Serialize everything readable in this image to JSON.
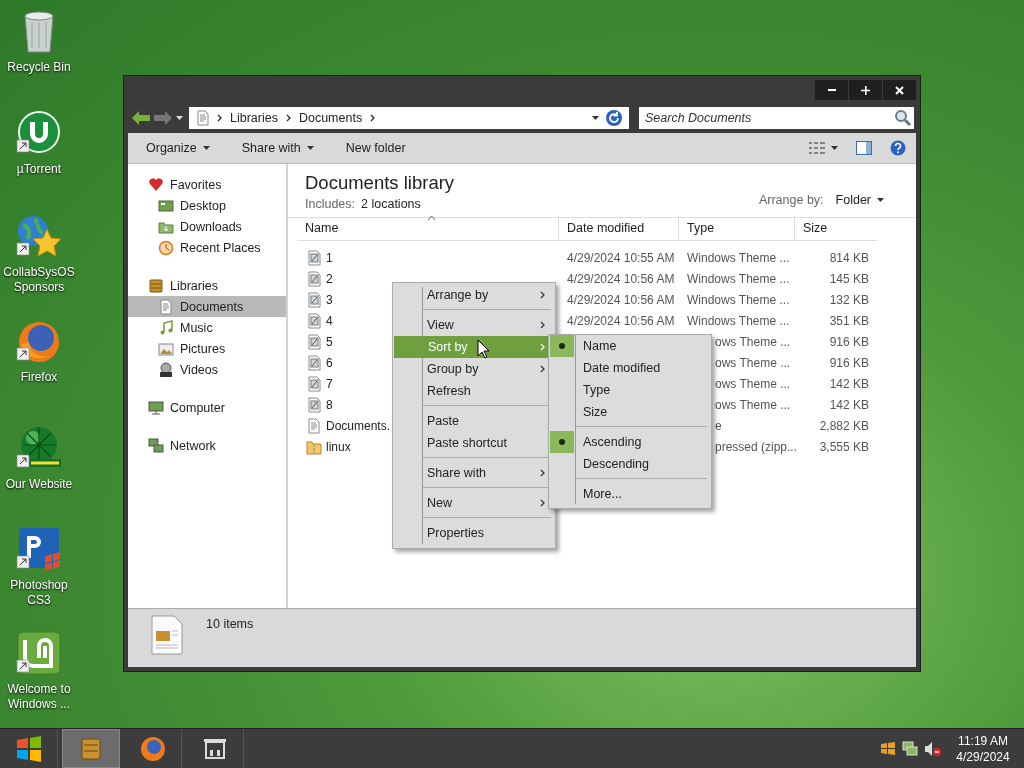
{
  "desktop_icons": [
    {
      "label": "Recycle Bin",
      "kind": "bin",
      "shortcut": false
    },
    {
      "label": "µTorrent",
      "kind": "torrent",
      "shortcut": true
    },
    {
      "label": "CollabSysOS Sponsors",
      "kind": "globe-star",
      "shortcut": true
    },
    {
      "label": "Firefox",
      "kind": "firefox",
      "shortcut": true
    },
    {
      "label": "Our Website",
      "kind": "sphere",
      "shortcut": true
    },
    {
      "label": "Photoshop CS3",
      "kind": "photoshop",
      "shortcut": true
    },
    {
      "label": "Welcome to Windows ...",
      "kind": "mint",
      "shortcut": true
    }
  ],
  "window": {
    "address": {
      "crumbs": [
        "Libraries",
        "Documents"
      ]
    },
    "search": {
      "placeholder": "Search Documents"
    },
    "toolbar": [
      {
        "label": "Organize",
        "dropdown": true
      },
      {
        "label": "Share with",
        "dropdown": true
      },
      {
        "label": "New folder",
        "dropdown": false
      }
    ],
    "nav": [
      {
        "label": "Favorites",
        "kind": "heart",
        "selected": false,
        "children": [
          {
            "label": "Desktop",
            "kind": "desktop",
            "selected": false
          },
          {
            "label": "Downloads",
            "kind": "downloads",
            "selected": false
          },
          {
            "label": "Recent Places",
            "kind": "recent",
            "selected": false
          }
        ]
      },
      {
        "label": "Libraries",
        "kind": "library",
        "selected": false,
        "children": [
          {
            "label": "Documents",
            "kind": "document",
            "selected": true
          },
          {
            "label": "Music",
            "kind": "music",
            "selected": false
          },
          {
            "label": "Pictures",
            "kind": "pictures",
            "selected": false
          },
          {
            "label": "Videos",
            "kind": "videos",
            "selected": false
          }
        ]
      },
      {
        "label": "Computer",
        "kind": "computer",
        "selected": false
      },
      {
        "label": "Network",
        "kind": "network",
        "selected": false
      }
    ],
    "library": {
      "title": "Documents library",
      "includes_label": "Includes:",
      "includes_value": "2 locations",
      "arrange_label": "Arrange by:",
      "arrange_value": "Folder"
    },
    "columns": [
      {
        "label": "Name",
        "sorted": true
      },
      {
        "label": "Date modified",
        "sorted": false
      },
      {
        "label": "Type",
        "sorted": false
      },
      {
        "label": "Size",
        "sorted": false
      }
    ],
    "rows": [
      {
        "name": "1",
        "kind": "theme",
        "date": "4/29/2024 10:55 AM",
        "type": "Windows Theme ...",
        "size": "814 KB"
      },
      {
        "name": "2",
        "kind": "theme",
        "date": "4/29/2024 10:56 AM",
        "type": "Windows Theme ...",
        "size": "145 KB"
      },
      {
        "name": "3",
        "kind": "theme",
        "date": "4/29/2024 10:56 AM",
        "type": "Windows Theme ...",
        "size": "132 KB"
      },
      {
        "name": "4",
        "kind": "theme",
        "date": "4/29/2024 10:56 AM",
        "type": "Windows Theme ...",
        "size": "351 KB"
      },
      {
        "name": "5",
        "kind": "theme",
        "type": "ows Theme ...",
        "size": "916 KB"
      },
      {
        "name": "6",
        "kind": "theme",
        "type": "ows Theme ...",
        "size": "916 KB"
      },
      {
        "name": "7",
        "kind": "theme",
        "type": "ows Theme ...",
        "size": "142 KB"
      },
      {
        "name": "8",
        "kind": "theme",
        "type": "ows Theme ...",
        "size": "142 KB"
      },
      {
        "name": "Documents.",
        "kind": "document",
        "type": "e",
        "size": "2,882 KB"
      },
      {
        "name": "linux",
        "kind": "zip",
        "type": "pressed (zipp...",
        "size": "3,555 KB"
      }
    ],
    "status": "10 items"
  },
  "context_menu": {
    "items": [
      {
        "kind": "item",
        "label": "Arrange by",
        "submenu": true,
        "selected": false
      },
      {
        "kind": "separator"
      },
      {
        "kind": "item",
        "label": "View",
        "submenu": true,
        "selected": false
      },
      {
        "kind": "item",
        "label": "Sort by",
        "submenu": true,
        "selected": true
      },
      {
        "kind": "item",
        "label": "Group by",
        "submenu": true,
        "selected": false
      },
      {
        "kind": "item",
        "label": "Refresh",
        "submenu": false,
        "selected": false
      },
      {
        "kind": "separator"
      },
      {
        "kind": "item",
        "label": "Paste",
        "submenu": false,
        "selected": false
      },
      {
        "kind": "item",
        "label": "Paste shortcut",
        "submenu": false,
        "selected": false
      },
      {
        "kind": "separator"
      },
      {
        "kind": "item",
        "label": "Share with",
        "submenu": true,
        "selected": false
      },
      {
        "kind": "separator"
      },
      {
        "kind": "item",
        "label": "New",
        "submenu": true,
        "selected": false
      },
      {
        "kind": "separator"
      },
      {
        "kind": "item",
        "label": "Properties",
        "submenu": false,
        "selected": false
      }
    ],
    "submenu": [
      {
        "kind": "item",
        "label": "Name",
        "checked": true
      },
      {
        "kind": "item",
        "label": "Date modified",
        "checked": false
      },
      {
        "kind": "item",
        "label": "Type",
        "checked": false
      },
      {
        "kind": "item",
        "label": "Size",
        "checked": false
      },
      {
        "kind": "separator"
      },
      {
        "kind": "item",
        "label": "Ascending",
        "checked": true
      },
      {
        "kind": "item",
        "label": "Descending",
        "checked": false
      },
      {
        "kind": "separator"
      },
      {
        "kind": "item",
        "label": "More...",
        "checked": false
      }
    ]
  },
  "taskbar": {
    "buttons": [
      {
        "kind": "explorer",
        "selected": true
      },
      {
        "kind": "firefox",
        "selected": false
      },
      {
        "kind": "store",
        "selected": false
      }
    ],
    "time": "11:19 AM",
    "date": "4/29/2024"
  }
}
